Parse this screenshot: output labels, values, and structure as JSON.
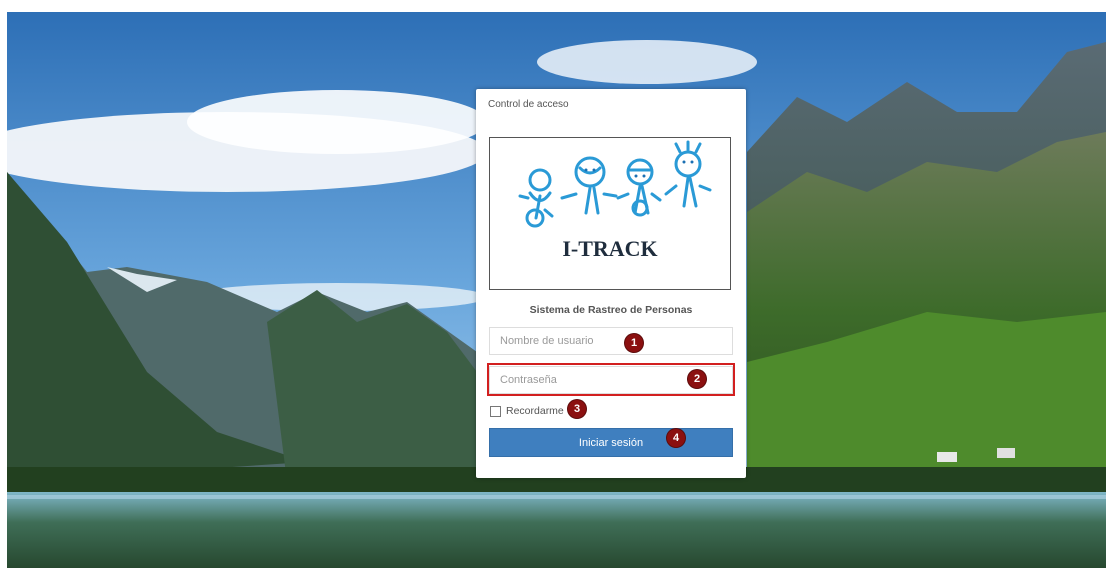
{
  "card": {
    "title": "Control de acceso",
    "logo_text": "I-TRACK",
    "subtitle": "Sistema de Rastreo de Personas"
  },
  "form": {
    "username_placeholder": "Nombre de usuario",
    "password_placeholder": "Contraseña",
    "remember_label": "Recordarme",
    "submit_label": "Iniciar sesión"
  },
  "annotations": [
    "1",
    "2",
    "3",
    "4"
  ],
  "colors": {
    "button": "#3f7fbf",
    "badge": "#8b1010",
    "highlight": "#d21f1f"
  }
}
